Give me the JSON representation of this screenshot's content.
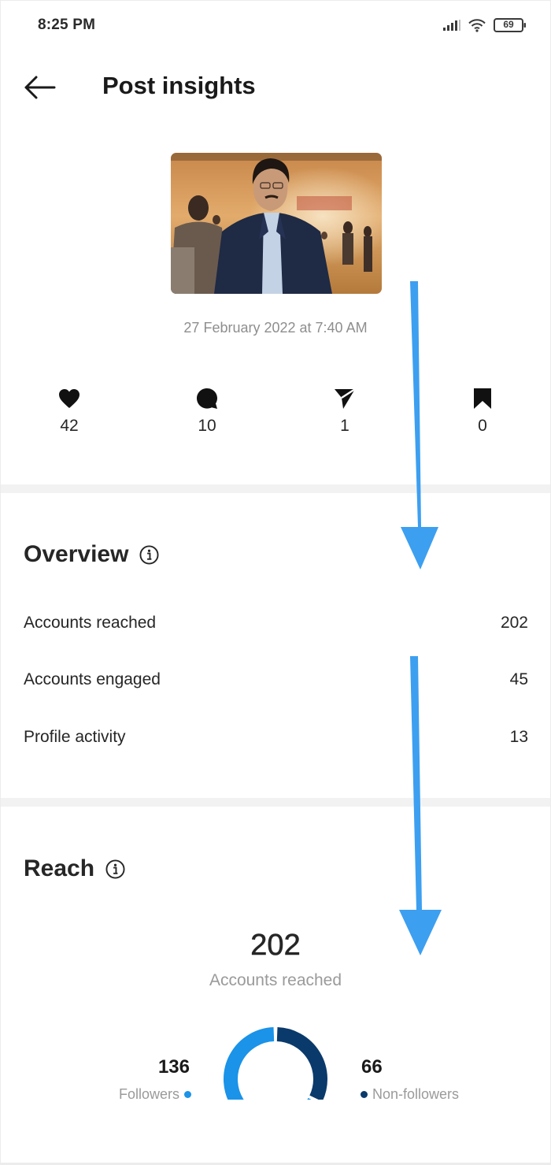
{
  "status_bar": {
    "time": "8:25 PM",
    "battery_level": "69",
    "icons": [
      "signal-icon",
      "wifi-icon",
      "battery-icon"
    ]
  },
  "header": {
    "back_icon": "arrow-left-icon",
    "title": "Post insights"
  },
  "post": {
    "thumbnail_alt": "Post photo: man in dark blazer at an event hall",
    "date": "27 February 2022 at 7:40 AM"
  },
  "stats": [
    {
      "icon": "heart-icon",
      "label": "Likes",
      "value": "42"
    },
    {
      "icon": "comment-icon",
      "label": "Comments",
      "value": "10"
    },
    {
      "icon": "share-icon",
      "label": "Shares",
      "value": "1"
    },
    {
      "icon": "bookmark-icon",
      "label": "Saves",
      "value": "0"
    }
  ],
  "overview": {
    "title": "Overview",
    "info_icon": "info-icon",
    "rows": [
      {
        "label": "Accounts reached",
        "value": "202"
      },
      {
        "label": "Accounts engaged",
        "value": "45"
      },
      {
        "label": "Profile activity",
        "value": "13"
      }
    ]
  },
  "reach": {
    "title": "Reach",
    "info_icon": "info-icon",
    "total": "202",
    "total_label": "Accounts reached",
    "followers": {
      "value": "136",
      "label": "Followers",
      "color": "#1a93e8"
    },
    "non_followers": {
      "value": "66",
      "label": "Non-followers",
      "color": "#0a3a6b"
    }
  },
  "annotation": {
    "arrow_color": "#3d9ff0",
    "arrows": [
      "scroll-down-arrow-1",
      "scroll-down-arrow-2"
    ]
  }
}
